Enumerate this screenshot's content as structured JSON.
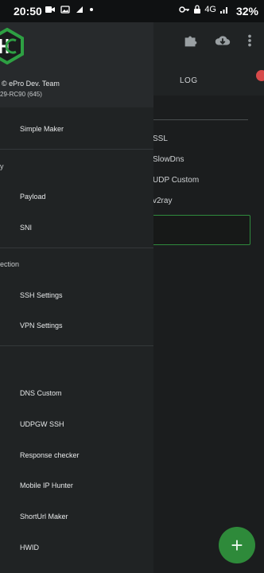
{
  "status_bar": {
    "time": "20:50",
    "network_label": "4G",
    "battery": "32%"
  },
  "background_app": {
    "tab_log": "LOG",
    "options": [
      "SSL",
      "SlowDns",
      "UDP Custom",
      "v2ray"
    ],
    "fab_symbol": "+"
  },
  "drawer": {
    "team": "© ePro Dev. Team",
    "version": "29-RC90 (645)",
    "items": {
      "simple_maker": "Simple Maker",
      "section_v": "y",
      "payload": "Payload",
      "sni": "SNI",
      "section_connection": "ection",
      "ssh_settings": "SSH Settings",
      "vpn_settings": "VPN Settings",
      "dns_custom": "DNS Custom",
      "udpgw_ssh": "UDPGW SSH",
      "response_checker": "Response checker",
      "mobile_ip_hunter": "Mobile IP Hunter",
      "shorturl_maker": "ShortUrl Maker",
      "hwid": "HWID"
    }
  },
  "colors": {
    "accent_green": "#2e8a3a",
    "drawer_bg": "#202324",
    "app_bg": "#1b1d1e"
  },
  "icons": {
    "status_left": [
      "video-camera-icon",
      "gallery-icon",
      "signal-icon",
      "dot-icon"
    ],
    "status_right": [
      "key-icon",
      "lock-icon",
      "network-4g-icon",
      "signal-bars-icon"
    ],
    "app_actions": [
      "puzzle-icon",
      "cloud-download-icon",
      "more-vert-icon"
    ]
  }
}
